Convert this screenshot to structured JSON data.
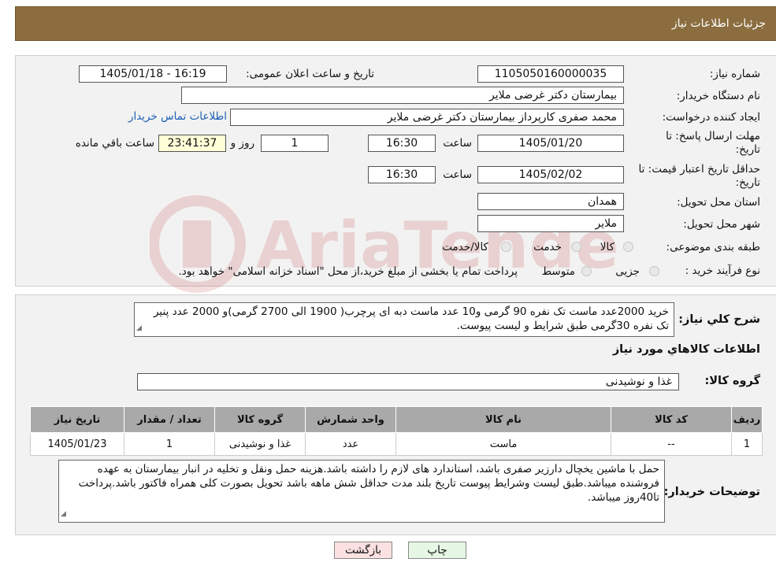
{
  "header": {
    "title": "جزئیات اطلاعات نیاز"
  },
  "form": {
    "need_number_label": "شماره نیاز:",
    "need_number": "1105050160000035",
    "announce_label": "تاریخ و ساعت اعلان عمومی:",
    "announce_value": "1405/01/18 - 16:19",
    "buyer_label": "نام دستگاه خریدار:",
    "buyer_value": "بیمارستان دکتر غرضی ملایر",
    "creator_label": "ایجاد کننده درخواست:",
    "creator_value": "محمد صفری کارپرداز بیمارستان دکتر غرضی ملایر",
    "contact_link": "اطلاعات تماس خریدار",
    "deadline_label_1": "مهلت ارسال پاسخ: تا",
    "deadline_label_2": "تاریخ:",
    "deadline_date": "1405/01/20",
    "time_label": "ساعت",
    "deadline_time": "16:30",
    "days_value": "1",
    "days_label": "روز و",
    "remaining_value": "23:41:37",
    "remaining_label": "ساعت باقي مانده",
    "validity_label_1": "حداقل تاریخ اعتبار قیمت: تا",
    "validity_label_2": "تاریخ:",
    "validity_date": "1405/02/02",
    "validity_time": "16:30",
    "province_label": "استان محل تحویل:",
    "province_value": "همدان",
    "city_label": "شهر محل تحویل:",
    "city_value": "ملایر",
    "category_label": "طبقه بندی موضوعی:",
    "category_options": [
      "کالا",
      "خدمت",
      "کالا/خدمت"
    ],
    "process_label": "نوع فرآیند خرید :",
    "process_options": [
      "جزیی",
      "متوسط"
    ],
    "process_note": "پرداخت تمام یا بخشی از مبلغ خرید،از محل \"اسناد خزانه اسلامی\" خواهد بود."
  },
  "summary": {
    "label": "شرح کلي نياز:",
    "text": "خرید  2000عدد ماست تک نفره 90 گرمی و10 عدد ماست دبه ای پرچرب( 1900 الی 2700  گرمی)و 2000 عدد پنیر تک نفره 30گرمی  طبق شرایط و لیست پیوست."
  },
  "goods": {
    "section_title": "اطلاعات کالاهاي مورد نياز",
    "group_label": "گروه کالا:",
    "group_value": "غذا و نوشیدنی",
    "columns": [
      "ردیف",
      "کد کالا",
      "نام کالا",
      "واحد شمارش",
      "گروه کالا",
      "تعداد / مقدار",
      "تاریخ نیاز"
    ],
    "rows": [
      [
        "1",
        "--",
        "ماست",
        "عدد",
        "غذا و نوشیدنی",
        "1",
        "1405/01/23"
      ]
    ]
  },
  "buyer_notes": {
    "label": "توضیحات خریدار:",
    "text": "حمل با ماشین یخچال دارزیر صفری باشد، استاندارد های لازم را داشته باشد.هزینه حمل ونقل و  تخلیه در انبار بیمارستان به عهده فروشنده میباشد.طبق لیست وشرایط پیوست تاریخ بلند مدت حداقل شش ماهه باشد تحویل بصورت کلی همراه فاکتور باشد.پرداخت تا40روز میباشد."
  },
  "buttons": {
    "print": "چاپ",
    "back": "بازگشت"
  },
  "watermark": {
    "text": "AriaTender.neT"
  }
}
